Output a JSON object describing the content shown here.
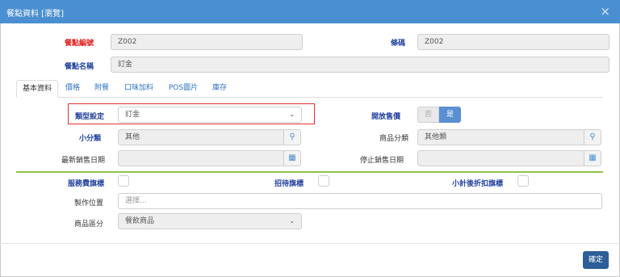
{
  "window": {
    "title": "餐點資料 [瀏覽]",
    "close_glyph": "×"
  },
  "header": {
    "code_label": "餐點編號",
    "code_value": "Z002",
    "barcode_label": "條碼",
    "barcode_value": "Z002",
    "name_label": "餐點名稱",
    "name_value": "訂金"
  },
  "tabs": [
    "基本資料",
    "價格",
    "附餐",
    "口味加料",
    "POS圖片",
    "庫存"
  ],
  "basic": {
    "type_label": "類型設定",
    "type_value": "訂金",
    "open_sale_label": "開放售價",
    "open_sale_no": "否",
    "open_sale_yes": "是",
    "open_sale_selected": "是",
    "subcat_label": "小分類",
    "subcat_value": "其他",
    "prodcat_label": "商品分類",
    "prodcat_value": "其他類",
    "latest_date_label": "最新銷售日期",
    "latest_date_value": "",
    "stop_date_label": "停止銷售日期",
    "stop_date_value": "",
    "service_fee_label": "服務費旗標",
    "service_fee_checked": false,
    "treat_label": "招待旗標",
    "treat_checked": false,
    "subtotal_discount_label": "小計後折扣旗標",
    "subtotal_discount_checked": false,
    "make_location_label": "製作位置",
    "make_location_placeholder": "選擇...",
    "product_type_label": "商品區分",
    "product_type_value": "餐飲商品"
  },
  "footer": {
    "confirm_label": "確定"
  },
  "colors": {
    "titlebar": "#4a8fd1",
    "accent": "#2c5f97",
    "required": "#e02020",
    "label_blue": "#1f3f9e",
    "divider": "#8bc34a"
  }
}
